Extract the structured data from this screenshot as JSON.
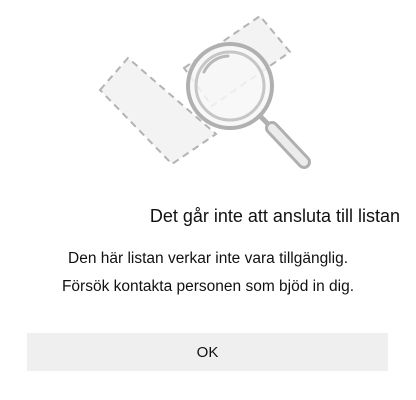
{
  "dialog": {
    "illustration_icon": "broken-list-magnifier-icon",
    "title": "Det går inte att ansluta till listan",
    "message_line1": "Den här listan verkar inte vara tillgänglig.",
    "message_line2": "Försök kontakta personen som bjöd in dig.",
    "ok_label": "OK"
  },
  "colors": {
    "background": "#ffffff",
    "button_background": "#efefef",
    "illustration_stroke": "#b0b0b0",
    "illustration_fill": "#f2f2f2",
    "text": "#111111"
  }
}
